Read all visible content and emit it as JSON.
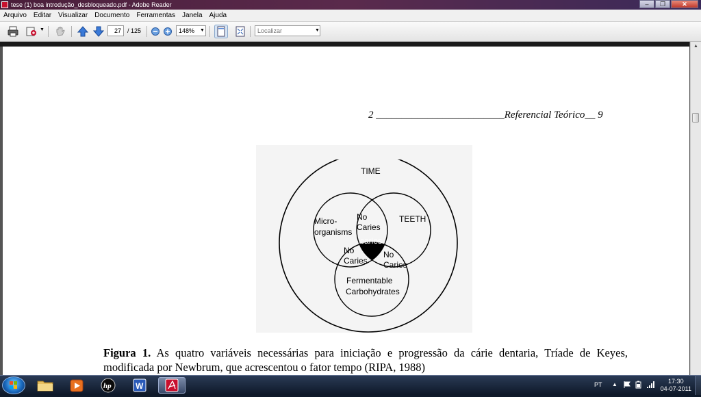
{
  "window": {
    "title": "tese (1) boa introdução_desbloqueado.pdf - Adobe Reader",
    "minimize": "–",
    "maximize": "❐",
    "close": "✕"
  },
  "menu": [
    "Arquivo",
    "Editar",
    "Visualizar",
    "Documento",
    "Ferramentas",
    "Janela",
    "Ajuda"
  ],
  "toolbar": {
    "current_page": "27",
    "total_pages": "/ 125",
    "zoom": "148%",
    "find_placeholder": "Localizar"
  },
  "document": {
    "header": "2 _________________________Referencial Teórico__ 9",
    "figure": {
      "outer_label": "TIME",
      "micro_1": "Micro-",
      "micro_2": "organisms",
      "teeth": "TEETH",
      "ferm_1": "Fermentable",
      "ferm_2": "Carbohydrates",
      "caries": "caries",
      "no_caries": [
        "No",
        "Caries"
      ]
    },
    "caption_bold": "Figura 1.",
    "caption_text": " As quatro variáveis necessárias para iniciação e progressão da cárie dentaria, Tríade de Keyes, modificada por Newbrum, que acrescentou o fator tempo (RIPA, 1988)"
  },
  "taskbar": {
    "language": "PT",
    "time": "17:30",
    "date": "04-07-2011"
  }
}
